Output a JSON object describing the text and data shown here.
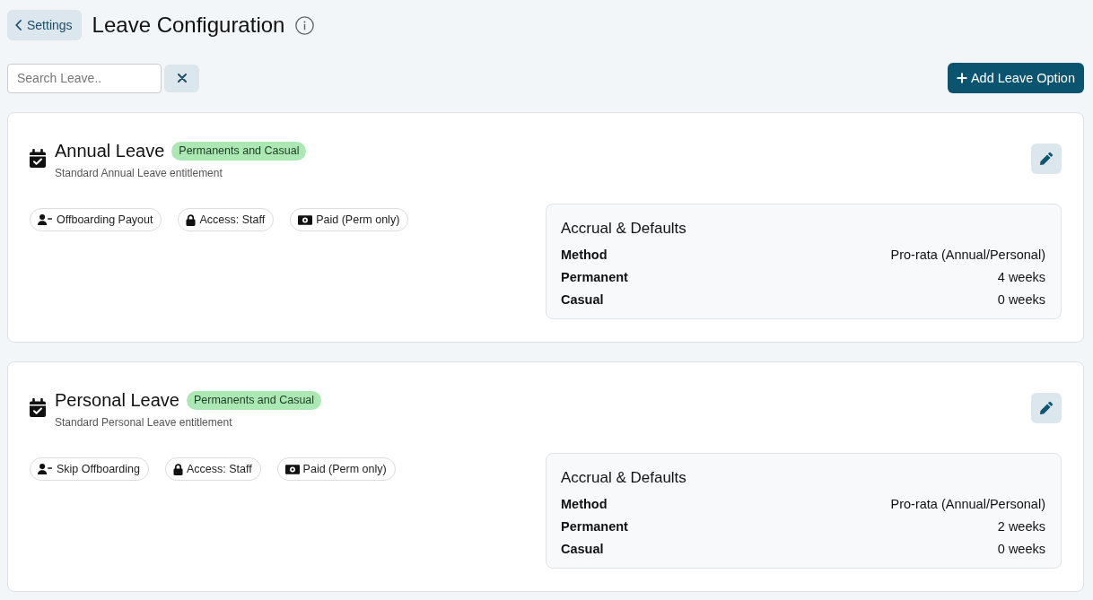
{
  "header": {
    "back_button": "Settings",
    "title": "Leave Configuration"
  },
  "toolbar": {
    "search": {
      "placeholder": "Search Leave.."
    },
    "add_button": "Add Leave Option"
  },
  "leave_types": [
    {
      "name": "Annual Leave",
      "badge": "Permanents and Casual",
      "description": "Standard Annual Leave entitlement",
      "tags": [
        {
          "kind": "person",
          "label": "Offboarding Payout"
        },
        {
          "kind": "lock",
          "label": "Access: Staff"
        },
        {
          "kind": "cash",
          "label": "Paid (Perm only)"
        }
      ],
      "accrual": {
        "title": "Accrual & Defaults",
        "rows": [
          {
            "label": "Method",
            "value": "Pro-rata (Annual/Personal)"
          },
          {
            "label": "Permanent",
            "value": "4 weeks"
          },
          {
            "label": "Casual",
            "value": "0 weeks"
          }
        ]
      }
    },
    {
      "name": "Personal Leave",
      "badge": "Permanents and Casual",
      "description": "Standard Personal Leave entitlement",
      "tags": [
        {
          "kind": "person",
          "label": "Skip Offboarding"
        },
        {
          "kind": "lock",
          "label": "Access: Staff"
        },
        {
          "kind": "cash",
          "label": "Paid (Perm only)"
        }
      ],
      "accrual": {
        "title": "Accrual & Defaults",
        "rows": [
          {
            "label": "Method",
            "value": "Pro-rata (Annual/Personal)"
          },
          {
            "label": "Permanent",
            "value": "2 weeks"
          },
          {
            "label": "Casual",
            "value": "0 weeks"
          }
        ]
      }
    }
  ]
}
